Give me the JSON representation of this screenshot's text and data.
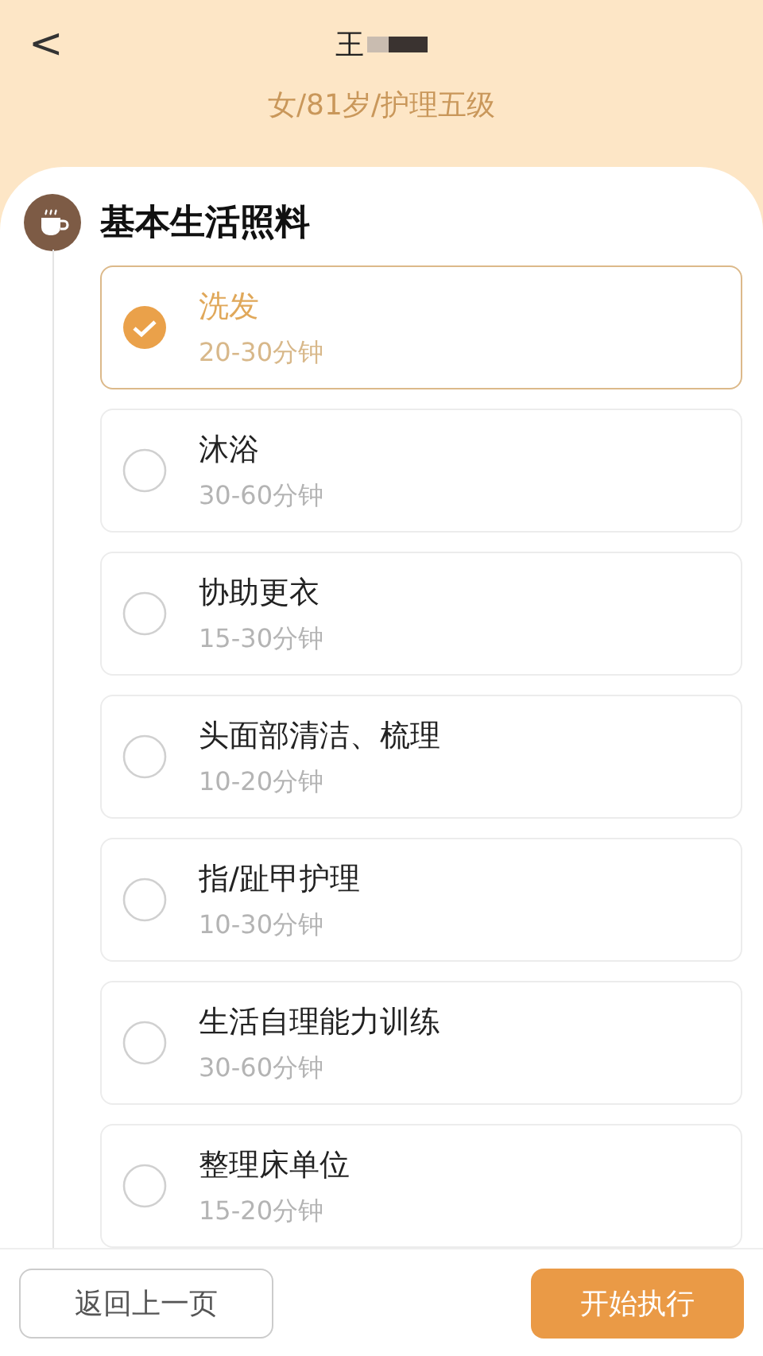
{
  "header": {
    "back": "<",
    "title": "王",
    "redacted": true,
    "subtitle": "女/81岁/护理五级"
  },
  "section": {
    "title": "基本生活照料",
    "items": [
      {
        "name": "洗发",
        "duration": "20-30分钟",
        "selected": true
      },
      {
        "name": "沐浴",
        "duration": "30-60分钟",
        "selected": false
      },
      {
        "name": "协助更衣",
        "duration": "15-30分钟",
        "selected": false
      },
      {
        "name": "头面部清洁、梳理",
        "duration": "10-20分钟",
        "selected": false
      },
      {
        "name": "指/趾甲护理",
        "duration": "10-30分钟",
        "selected": false
      },
      {
        "name": "生活自理能力训练",
        "duration": "30-60分钟",
        "selected": false
      },
      {
        "name": "整理床单位",
        "duration": "15-20分钟",
        "selected": false
      }
    ]
  },
  "buttons": {
    "back": "返回上一页",
    "start": "开始执行"
  }
}
